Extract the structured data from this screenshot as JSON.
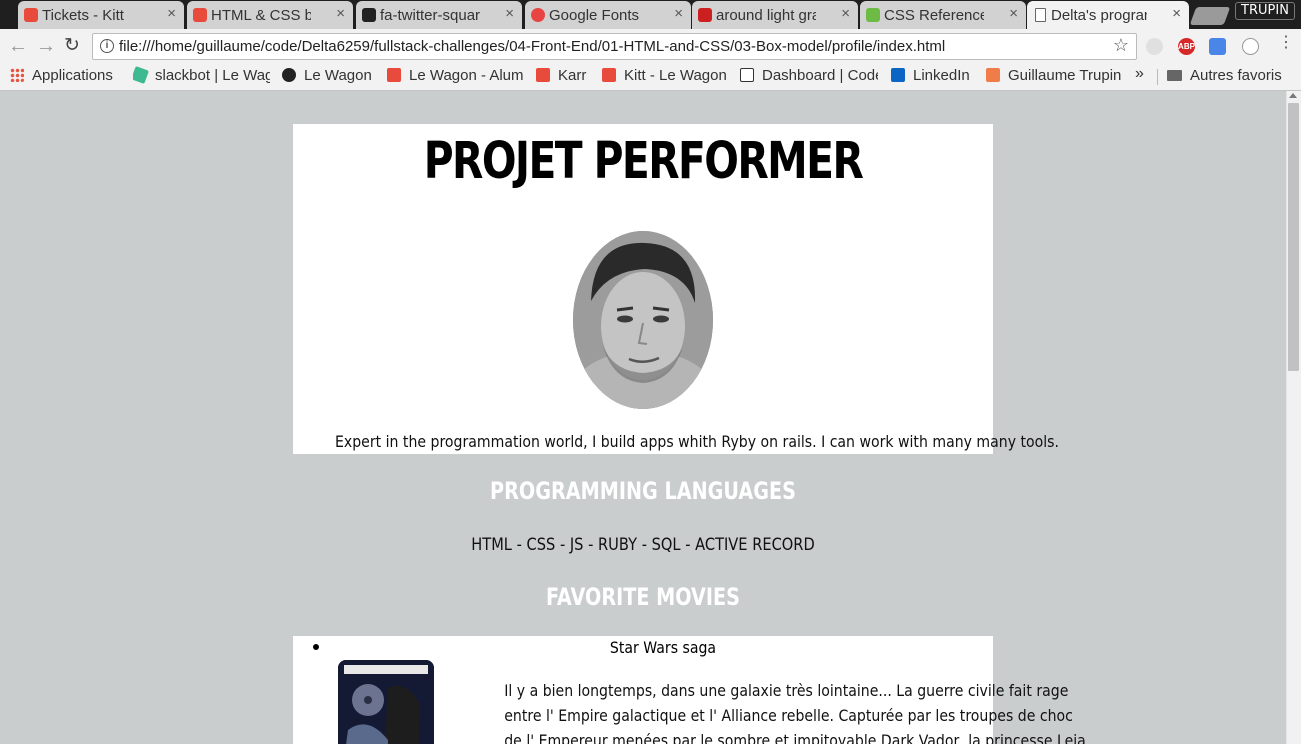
{
  "tabs": [
    {
      "label": "Tickets - Kitt",
      "favicon": "lewagon-icon",
      "color": "#e84b3c",
      "active": false
    },
    {
      "label": "HTML & CSS basics",
      "favicon": "lewagon-icon",
      "color": "#e84b3c",
      "active": false
    },
    {
      "label": "fa-twitter-square",
      "favicon": "flag-icon",
      "color": "#222222",
      "active": false
    },
    {
      "label": "Google Fonts",
      "favicon": "google-fonts-icon",
      "color": "#e94444",
      "active": false
    },
    {
      "label": "around light gray",
      "favicon": "adobe-icon",
      "color": "#cc1f1f",
      "active": false
    },
    {
      "label": "CSS Reference",
      "favicon": "css-reference-icon",
      "color": "#6dbb45",
      "active": false
    },
    {
      "label": "Delta's programming",
      "favicon": "document-icon",
      "color": "#666666",
      "active": true
    }
  ],
  "close_glyph": "×",
  "profile_button": "TRUPIN",
  "toolbar": {
    "back": "←",
    "forward": "→",
    "reload": "↻",
    "url": "file:///home/guillaume/code/Delta6259/fullstack-challenges/04-Front-End/01-HTML-and-CSS/03-Box-model/profile/index.html",
    "info_glyph": "i",
    "star": "☆",
    "abp_label": "ABP",
    "menu": "⋮"
  },
  "bookmarks": [
    {
      "label": "Applications",
      "icon": "apps-grid-icon",
      "color": "#e7543f"
    },
    {
      "label": "slackbot | Le Wagon",
      "icon": "slack-icon",
      "color": "#3eb991"
    },
    {
      "label": "Le Wagon",
      "icon": "github-icon",
      "color": "#222222"
    },
    {
      "label": "Le Wagon - Alumni",
      "icon": "lewagon-icon",
      "color": "#e84b3c"
    },
    {
      "label": "Karr",
      "icon": "lewagon-icon",
      "color": "#e84b3c"
    },
    {
      "label": "Kitt - Le Wagon",
      "icon": "lewagon-icon",
      "color": "#e84b3c"
    },
    {
      "label": "Dashboard | Codecademy",
      "icon": "codecademy-icon",
      "color": "#333333"
    },
    {
      "label": "LinkedIn",
      "icon": "linkedin-icon",
      "color": "#0a66c2"
    },
    {
      "label": "Guillaume Trupin",
      "icon": "profile-icon",
      "color": "#f07c4a"
    }
  ],
  "bookmarks_more": "»",
  "other_bookmarks": "Autres favoris",
  "page": {
    "title": "PROJET PERFORMER",
    "bio": "Expert in the programmation world, I build apps whith Ryby on rails. I can work with many many tools.",
    "programming_title": "PROGRAMMING LANGUAGES",
    "languages": "HTML - CSS - JS - RUBY - SQL - ACTIVE RECORD",
    "movies_title": "FAVORITE MOVIES",
    "movies": [
      {
        "title": "Star Wars saga",
        "lines": [
          "Il y a bien longtemps, dans une galaxie très lointaine... La guerre civile fait rage",
          "entre l' Empire galactique et l' Alliance rebelle. Capturée par les troupes de choc",
          "de l' Empereur menées par le sombre et impitoyable Dark Vador, la princesse Leia"
        ]
      }
    ]
  },
  "colors": {
    "page_background": "#c9cdce",
    "card_background": "#ffffff",
    "section_title": "#ffffff"
  }
}
